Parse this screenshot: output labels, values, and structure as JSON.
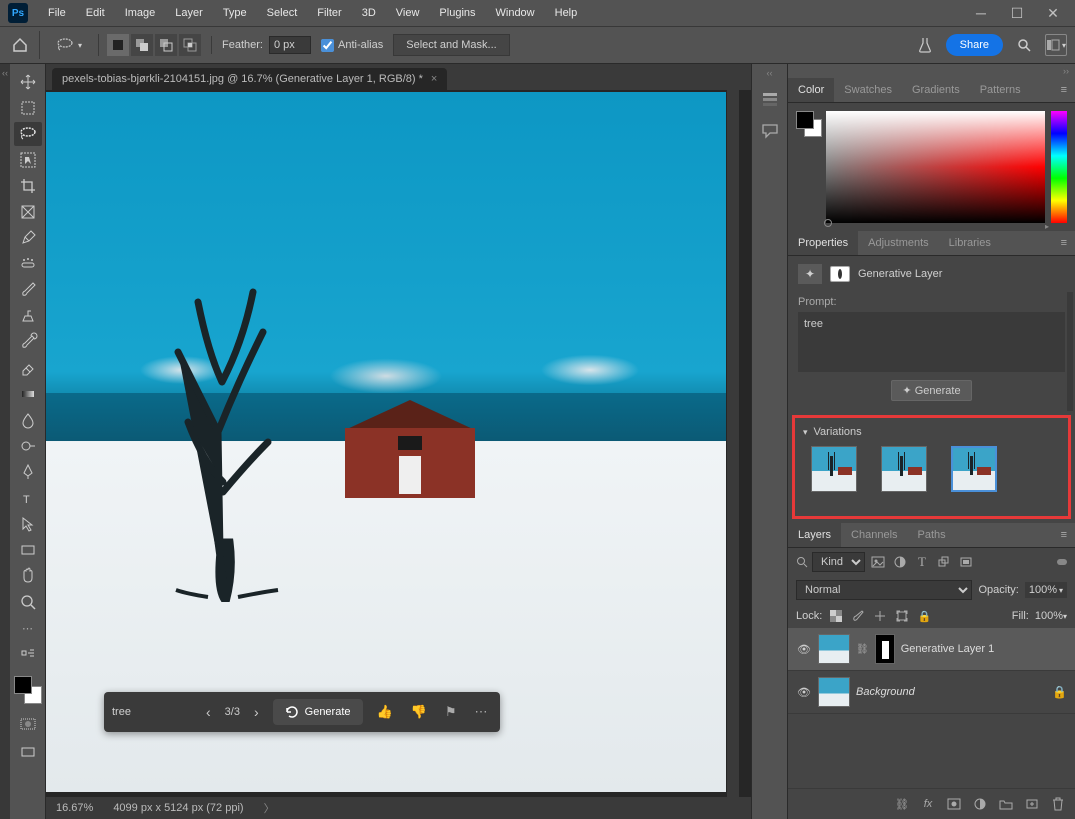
{
  "menubar": {
    "logo": "Ps",
    "items": [
      "File",
      "Edit",
      "Image",
      "Layer",
      "Type",
      "Select",
      "Filter",
      "3D",
      "View",
      "Plugins",
      "Window",
      "Help"
    ]
  },
  "options": {
    "feather_label": "Feather:",
    "feather_value": "0 px",
    "antialias_label": "Anti-alias",
    "select_mask": "Select and Mask...",
    "share": "Share"
  },
  "doc": {
    "tab_title": "pexels-tobias-bjørkli-2104151.jpg @ 16.7% (Generative Layer 1, RGB/8) *",
    "zoom": "16.67%",
    "dims": "4099 px x 5124 px (72 ppi)"
  },
  "ctx": {
    "prompt": "tree",
    "count": "3/3",
    "generate": "Generate"
  },
  "panels": {
    "color_tabs": [
      "Color",
      "Swatches",
      "Gradients",
      "Patterns"
    ],
    "props_tabs": [
      "Properties",
      "Adjustments",
      "Libraries"
    ],
    "gen_layer_label": "Generative Layer",
    "prompt_label": "Prompt:",
    "prompt_value": "tree",
    "generate_btn": "Generate",
    "variations_label": "Variations",
    "layers_tabs": [
      "Layers",
      "Channels",
      "Paths"
    ],
    "filter_kind": "Kind",
    "blend_mode": "Normal",
    "opacity_label": "Opacity:",
    "opacity_value": "100%",
    "lock_label": "Lock:",
    "fill_label": "Fill:",
    "fill_value": "100%",
    "layers": [
      {
        "name": "Generative Layer 1",
        "selected": true,
        "mask": true,
        "italic": false
      },
      {
        "name": "Background",
        "selected": false,
        "mask": false,
        "italic": true,
        "locked": true
      }
    ]
  }
}
